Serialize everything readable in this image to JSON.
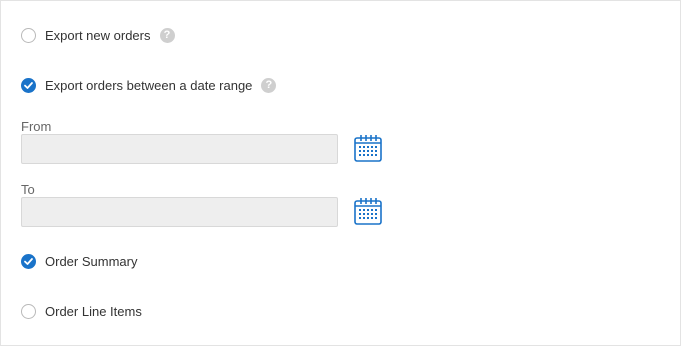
{
  "options": {
    "export_new": {
      "label": "Export new orders",
      "checked": false
    },
    "export_range": {
      "label": "Export orders between a date range",
      "checked": true
    },
    "order_summary": {
      "label": "Order Summary",
      "checked": true
    },
    "order_line_items": {
      "label": "Order Line Items",
      "checked": false
    }
  },
  "date_range": {
    "from_label": "From",
    "from_value": "",
    "to_label": "To",
    "to_value": ""
  },
  "icons": {
    "help": "question-mark-icon",
    "calendar": "calendar-icon",
    "check": "checkmark-icon"
  },
  "colors": {
    "accent": "#1a73c9",
    "help": "#cfcfcf",
    "input_bg": "#eeeeee"
  }
}
